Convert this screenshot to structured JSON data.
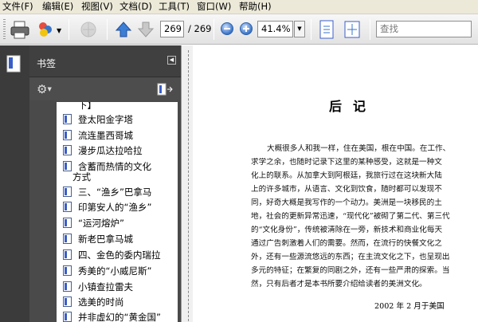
{
  "menu": [
    "文件(F)",
    "编辑(E)",
    "视图(V)",
    "文档(D)",
    "工具(T)",
    "窗口(W)",
    "帮助(H)"
  ],
  "toolbar": {
    "current_page": "269",
    "total_pages": "/ 269",
    "zoom": "41.4%",
    "search_placeholder": "查找"
  },
  "sidebar": {
    "title": "书签",
    "bookmarks": [
      {
        "label": "下】"
      },
      {
        "label": "登太阳金字塔"
      },
      {
        "label": "流连墨西哥城"
      },
      {
        "label": "漫步瓜达拉哈拉"
      },
      {
        "label": "含蓄而热情的文化",
        "label2": "方式"
      },
      {
        "label": "三、“渔乡”巴拿马"
      },
      {
        "label": "印第安人的“渔乡”"
      },
      {
        "label": "“运河熔炉”"
      },
      {
        "label": "新老巴拿马城"
      },
      {
        "label": "四、金色的委内瑞拉"
      },
      {
        "label": "秀美的“小威尼斯”"
      },
      {
        "label": "小镇查拉雷夫"
      },
      {
        "label": "选美的时尚"
      },
      {
        "label": "并非虚幻的“黄金国”"
      }
    ]
  },
  "document": {
    "title": "后记",
    "lines": [
      "大概很多人和我一样，住在美国，根在中国。在工作、",
      "求学之余，也随时记录下这里的某种感受，这就是一种文",
      "化上的联系。从加拿大到阿根廷，我旅行过在这块新大陆",
      "上的许多城市，从语言、文化到饮食，随时都可以发现不",
      "同，好奇大概是我写作的一个动力。美洲是一块移民的土",
      "地，社会的更新异常迅速，“现代化”被砌了第二代、第三代",
      "的“文化身份”，传统被清除在一旁，新技术和商业化每天",
      "通过广告刺激着人们的需要。然而，在流行的快餐文化之",
      "外，还有一些源流悠远的东西；在主流文化之下，也呈现出",
      "多元的特征；在繁复的同剧之外，还有一些严肃的探索。当",
      "然，只有后者才是本书所要介绍给读者的美洲文化。"
    ],
    "signature": "2002 年 2 月于美国"
  }
}
